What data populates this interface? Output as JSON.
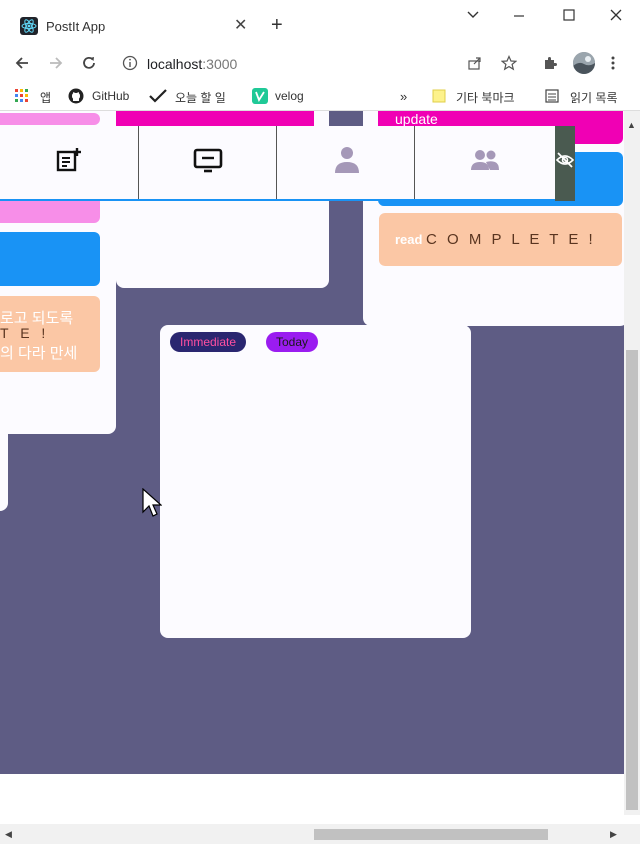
{
  "browser": {
    "tab_title": "PostIt App",
    "tab_close": "✕",
    "new_tab": "+",
    "url_host": "localhost",
    "url_port": ":3000",
    "bookmarks": [
      {
        "label": "앱"
      },
      {
        "label": "GitHub"
      },
      {
        "label": "오늘 할 일"
      },
      {
        "label": "velog"
      },
      {
        "label": "기타 북마크"
      },
      {
        "label": "읽기 목록"
      }
    ]
  },
  "app": {
    "right_card": {
      "update_label": "update",
      "complete_button_label": "C O M P L E T E !",
      "read_label": "read"
    },
    "left_card": {
      "korean_line1": "로고 되도록",
      "korean_line2": "의 다라 만세",
      "complete_partial": "T E !"
    },
    "center_note": {
      "priority_tag": "Immediate",
      "due_tag": "Today"
    }
  },
  "colors": {
    "page_bg": "#5e5c84",
    "magenta": "#f000b4",
    "blue": "#1993f5",
    "peach": "#fbc7a5",
    "pink": "#f78ee8",
    "immediate_bg": "#2a2670",
    "immediate_text": "#ff4fa0",
    "today_bg": "#9a1cf0"
  }
}
